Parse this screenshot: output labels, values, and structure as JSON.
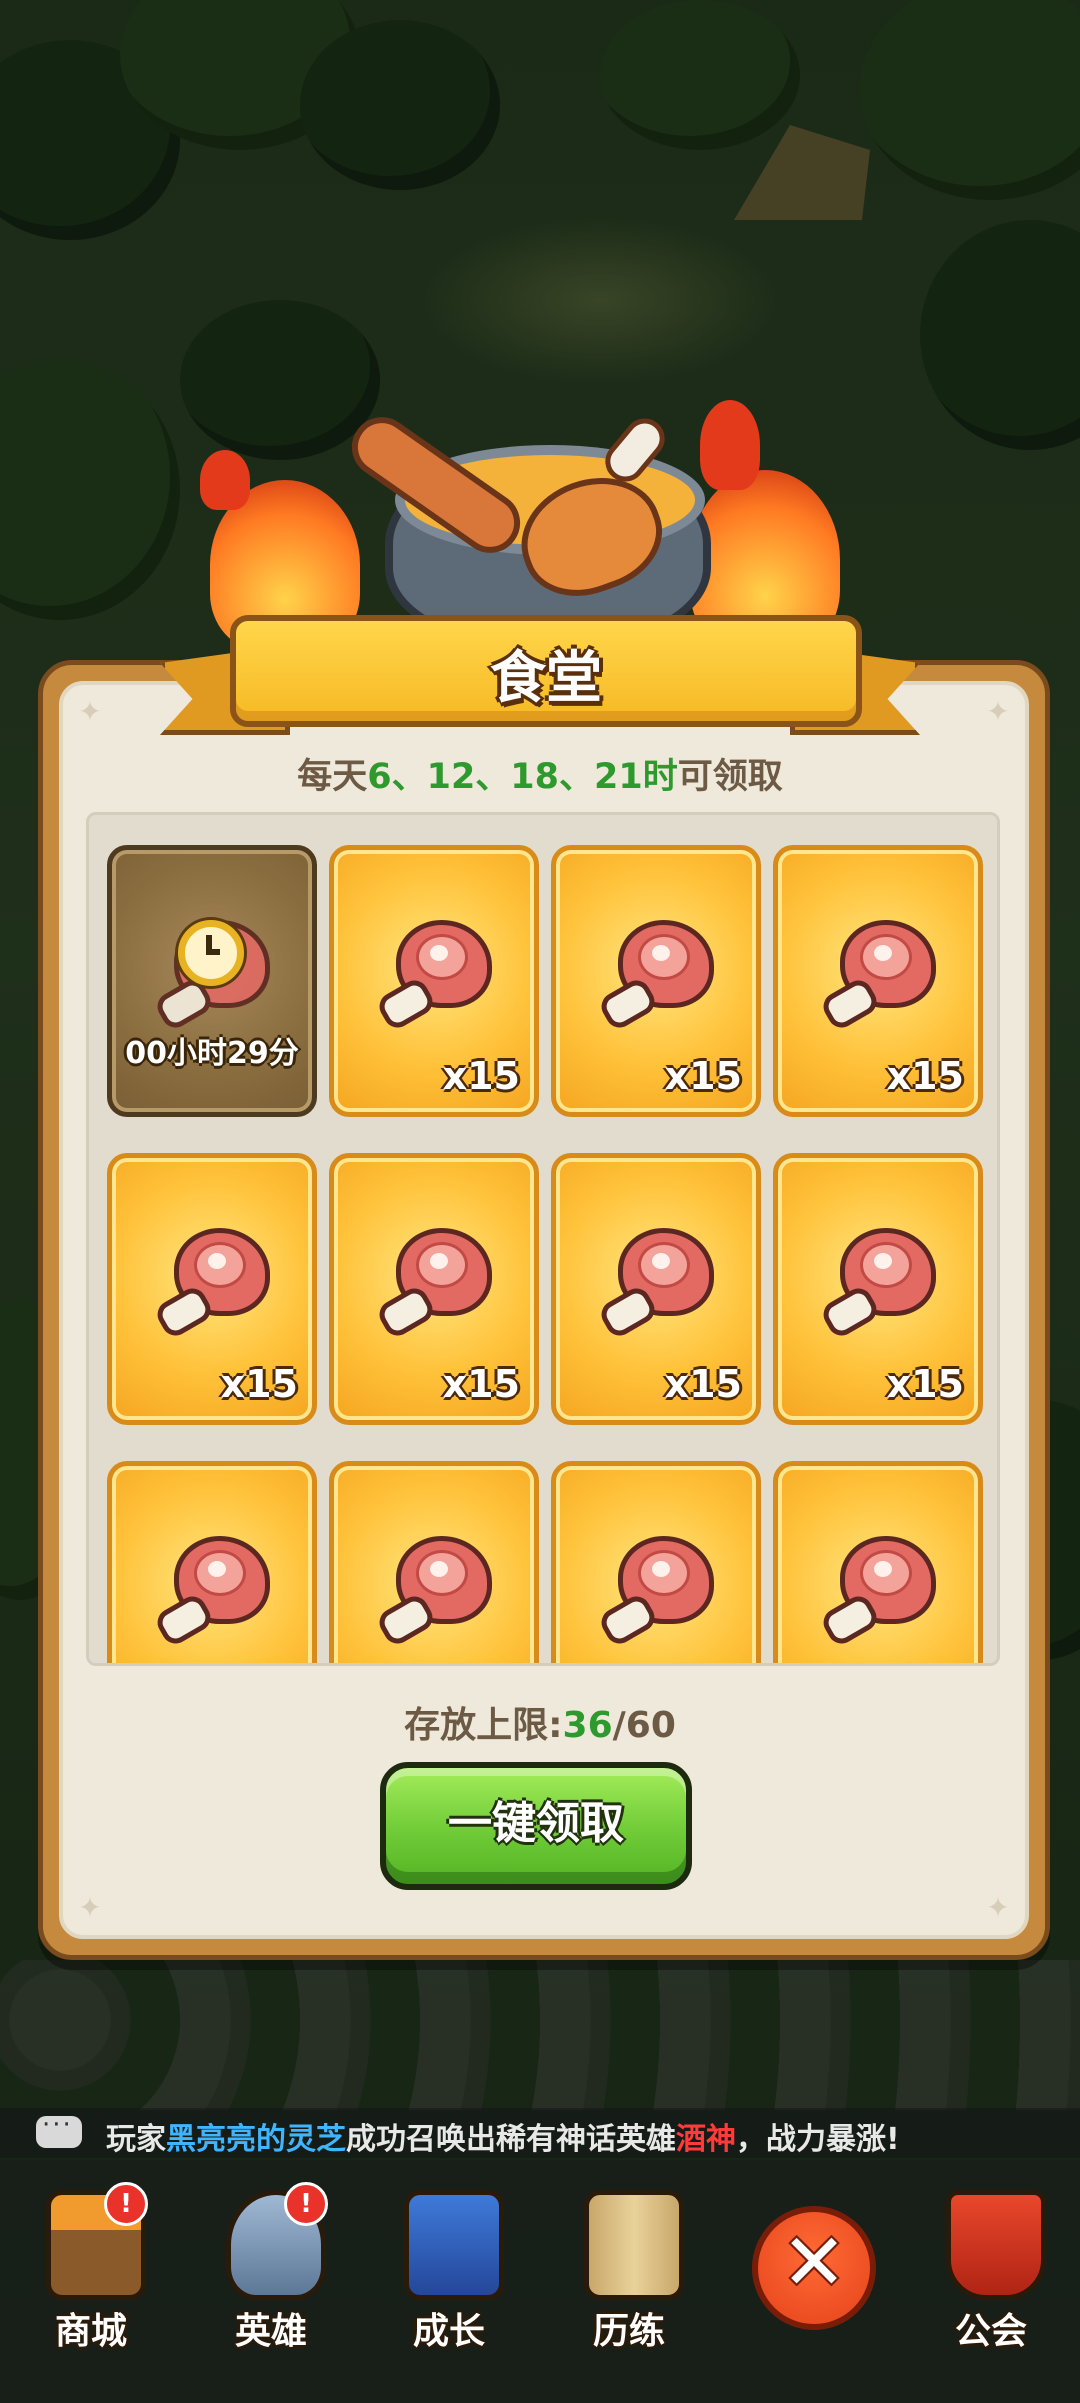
{
  "dialog": {
    "title": "食堂",
    "schedule": {
      "prefix": "每天",
      "hours": "6、12、18、21时",
      "suffix": "可领取"
    },
    "locked_slot": {
      "timer": "00小时29分"
    },
    "reward_quantity": "x15",
    "visible_reward_slots": 11,
    "capacity": {
      "label": "存放上限:",
      "current": "36",
      "separator": "/",
      "max": "60"
    },
    "claim_all_button": "一键领取"
  },
  "ticker": {
    "prefix": "玩家",
    "player": "黑亮亮的灵芝",
    "middle": "成功召唤出稀有神话英雄",
    "hero": "酒神",
    "suffix": "，战力暴涨!"
  },
  "nav": {
    "items": [
      {
        "label": "商城",
        "badge": "!",
        "icon": "shop-icon"
      },
      {
        "label": "英雄",
        "badge": "!",
        "icon": "helmet-icon"
      },
      {
        "label": "成长",
        "badge": "",
        "icon": "growth-book-icon"
      },
      {
        "label": "历练",
        "badge": "",
        "icon": "scroll-map-icon"
      },
      {
        "label": "公会",
        "badge": "",
        "icon": "guild-banner-icon"
      }
    ],
    "close_icon": "close-icon"
  },
  "colors": {
    "accent_green": "#2e9a2e",
    "player_blue": "#3fb4ff",
    "hero_red": "#ff3a3a",
    "button_green": "#6fcb37",
    "card_gold": "#ffc23a"
  }
}
